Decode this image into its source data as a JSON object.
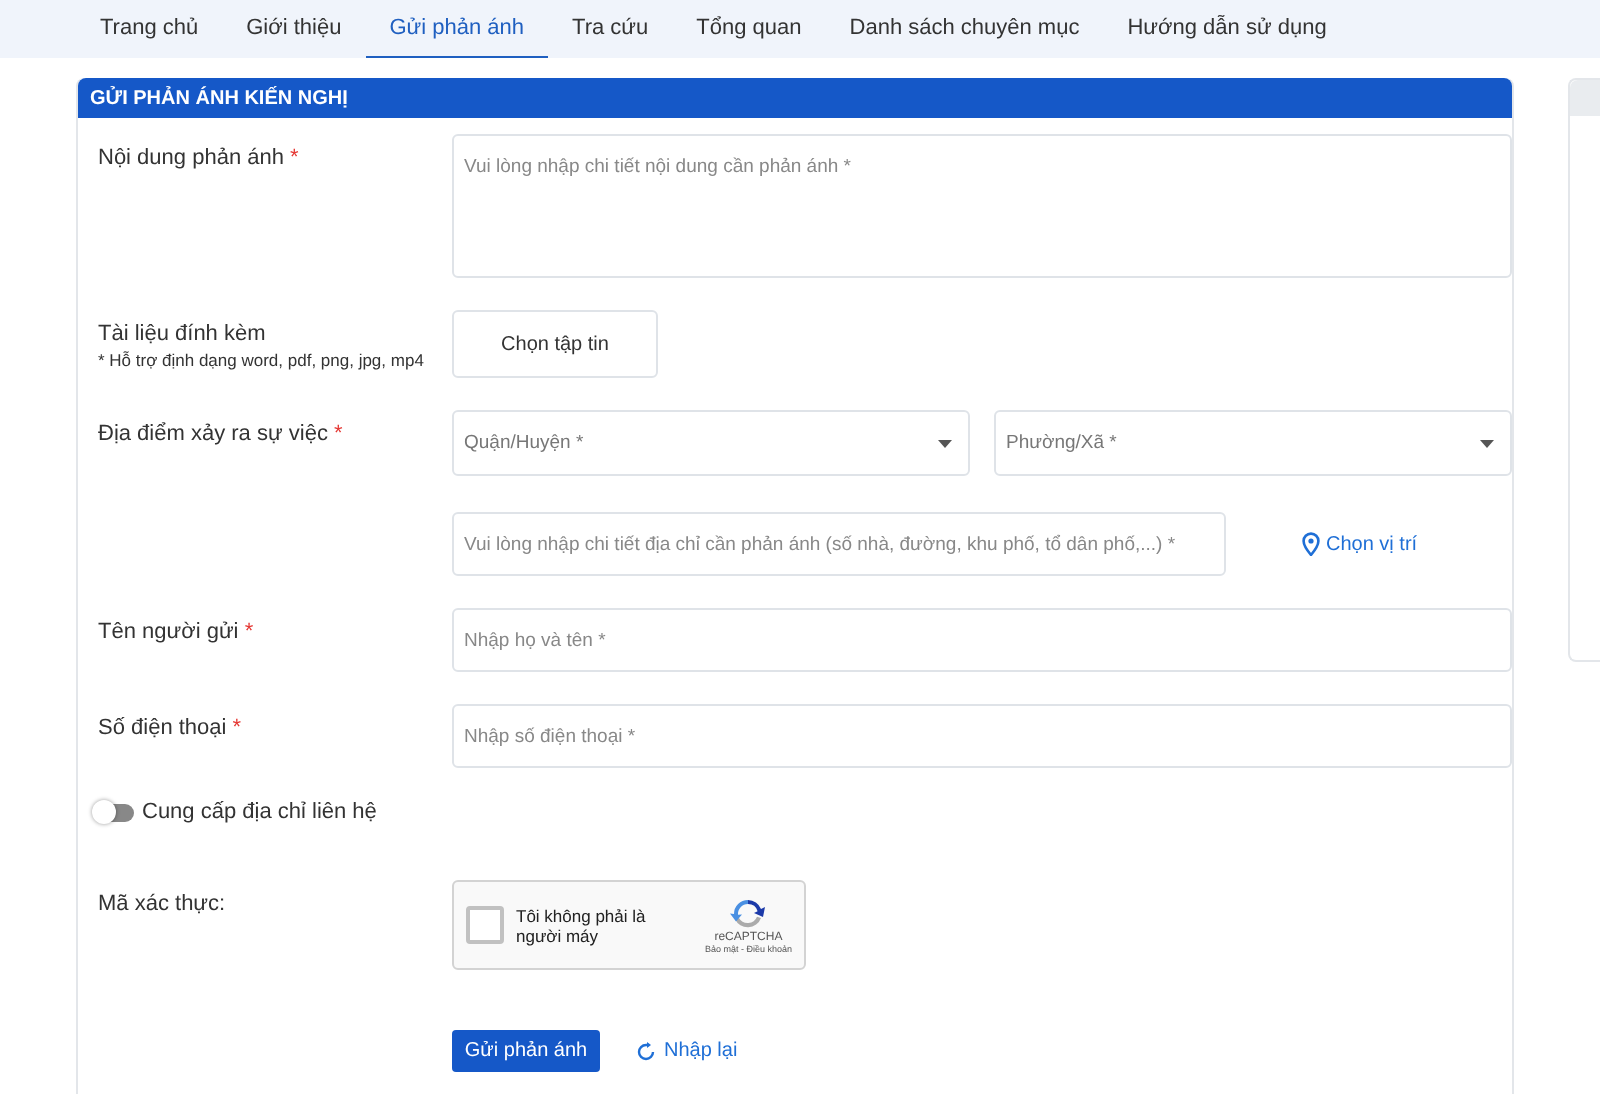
{
  "tabs": [
    {
      "label": "Trang chủ",
      "selected": false
    },
    {
      "label": "Giới thiệu",
      "selected": false
    },
    {
      "label": "Gửi phản ánh",
      "selected": true
    },
    {
      "label": "Tra cứu",
      "selected": false
    },
    {
      "label": "Tổng quan",
      "selected": false
    },
    {
      "label": "Danh sách chuyên mục",
      "selected": false
    },
    {
      "label": "Hướng dẫn sử dụng",
      "selected": false
    }
  ],
  "form": {
    "title": "GỬI PHẢN ÁNH KIẾN NGHỊ",
    "content": {
      "label": "Nội dung phản ánh",
      "mark": "*",
      "placeholder": "Vui lòng nhập chi tiết nội dung cần phản ánh *"
    },
    "attachment": {
      "label": "Tài liệu đính kèm",
      "hint": "* Hỗ trợ định dạng word, pdf, png, jpg, mp4",
      "button": "Chọn tập tin"
    },
    "location": {
      "label": "Địa điểm xảy ra sự việc",
      "mark": "*",
      "district": "Quận/Huyện *",
      "ward": "Phường/Xã *",
      "address_placeholder": "Vui lòng nhập chi tiết địa chỉ cần phản ánh (số nhà, đường, khu phố, tổ dân phố,...) *",
      "pick_link": "Chọn vị trí"
    },
    "name": {
      "label": "Tên người gửi",
      "mark": "*",
      "placeholder": "Nhập họ và tên *"
    },
    "phone": {
      "label": "Số điện thoại",
      "mark": "*",
      "placeholder": "Nhập số điện thoại *"
    },
    "contact_toggle": {
      "label": "Cung cấp địa chỉ liên hệ",
      "on": false
    },
    "captcha": {
      "label": "Mã xác thực:",
      "checkbox_label": "Tôi không phải là người máy",
      "checked": false,
      "brand": "reCAPTCHA",
      "links": "Bảo mật - Điều khoản"
    },
    "submit": "Gửi phản ánh",
    "reset": "Nhập lại"
  }
}
